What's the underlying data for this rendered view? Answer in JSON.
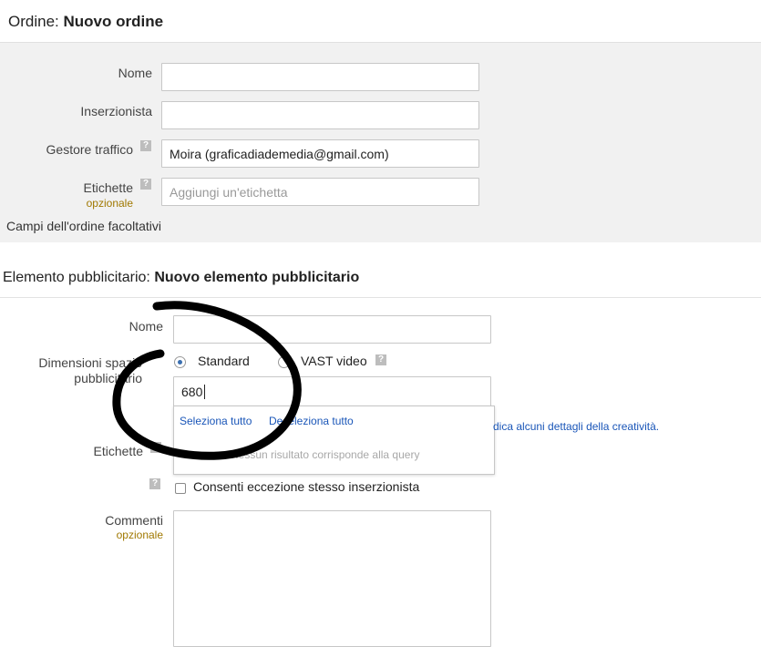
{
  "order": {
    "title_prefix": "Ordine: ",
    "title_name": "Nuovo ordine",
    "fields": {
      "name_label": "Nome",
      "name_value": "",
      "advertiser_label": "Inserzionista",
      "advertiser_value": "",
      "trafficker_label": "Gestore traffico",
      "trafficker_value": "Moira (graficadiademedia@gmail.com)",
      "labels_label": "Etichette",
      "labels_optional": "opzionale",
      "labels_placeholder": "Aggiungi un'etichetta"
    },
    "optional_fields_link": "Campi dell'ordine facoltativi"
  },
  "line_item": {
    "title_prefix": "Elemento pubblicitario: ",
    "title_name": "Nuovo elemento pubblicitario",
    "name_label": "Nome",
    "name_value": "",
    "sizes_label_line1": "Dimensioni spazio",
    "sizes_label_line2": "pubblicitario",
    "radio_standard": "Standard",
    "radio_vast": "VAST video",
    "selected_radio": "Standard",
    "size_input_value": "680",
    "dropdown": {
      "select_all": "Seleziona tutto",
      "deselect_all": "Deseleziona tutto",
      "no_results": "Nessun risultato corrisponde alla query"
    },
    "side_hint": "dica alcuni dettagli della creatività.",
    "labels_label": "Etichette",
    "same_advertiser_exception": "Consenti eccezione stesso inserzionista",
    "comments_label": "Commenti",
    "comments_optional": "opzionale",
    "comments_value": ""
  },
  "icons": {
    "help": "?"
  },
  "colors": {
    "panel_bg": "#f1f1f1",
    "link": "#1a56b8",
    "optional": "#a07800",
    "radio_selected": "#3b6fb0",
    "annotation": "#000000"
  }
}
